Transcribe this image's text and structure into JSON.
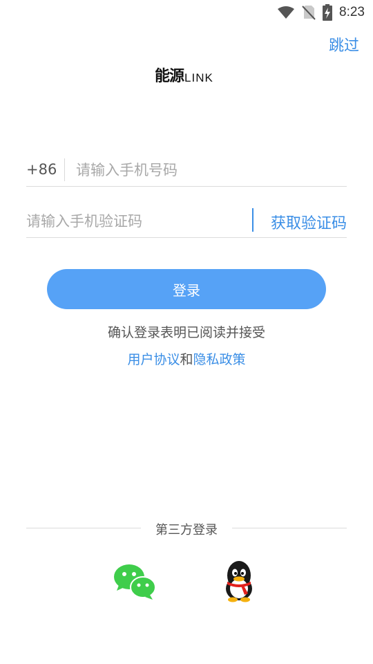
{
  "status_bar": {
    "time": "8:23",
    "icons": [
      "wifi-icon",
      "no-sim-icon",
      "battery-charging-icon"
    ]
  },
  "header": {
    "skip_label": "跳过"
  },
  "logo": {
    "cn_text": "能源",
    "en_text": "LINK"
  },
  "phone_field": {
    "prefix": "+86",
    "placeholder": "请输入手机号码"
  },
  "code_field": {
    "placeholder": "请输入手机验证码",
    "get_code_label": "获取验证码"
  },
  "login": {
    "button_label": "登录"
  },
  "agreement": {
    "text": "确认登录表明已阅读并接受",
    "user_agreement": "用户协议",
    "and": "和",
    "privacy_policy": "隐私政策"
  },
  "third_party": {
    "label": "第三方登录",
    "providers": [
      "wechat-icon",
      "qq-icon"
    ]
  },
  "colors": {
    "accent": "#3a8ee6",
    "button": "#56a2f6",
    "wechat": "#3fcd4b"
  }
}
